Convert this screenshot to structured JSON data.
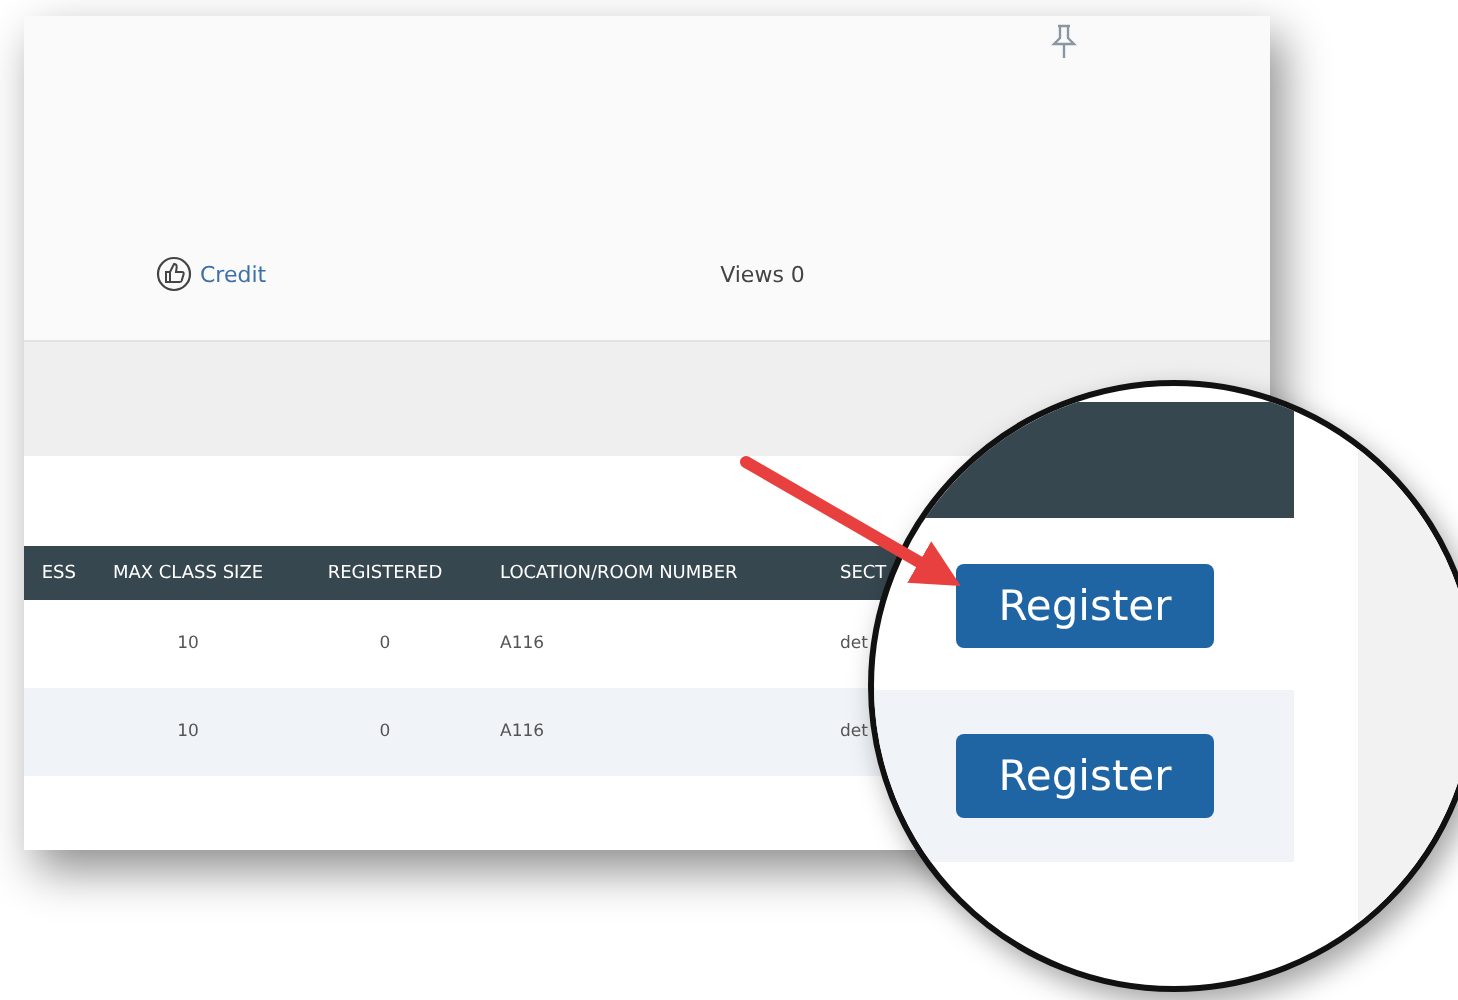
{
  "post": {
    "credit": "Credit",
    "views": "Views 0"
  },
  "table": {
    "columns": [
      "ESS",
      "MAX CLASS SIZE",
      "REGISTERED",
      "LOCATION/ROOM NUMBER",
      "SECT"
    ],
    "rows": [
      {
        "max_class_size": "10",
        "registered": "0",
        "location": "A116",
        "section": "det"
      },
      {
        "max_class_size": "10",
        "registered": "0",
        "location": "A116",
        "section": "det"
      }
    ]
  },
  "magnifier": {
    "buttons": [
      "Register",
      "Register"
    ]
  }
}
